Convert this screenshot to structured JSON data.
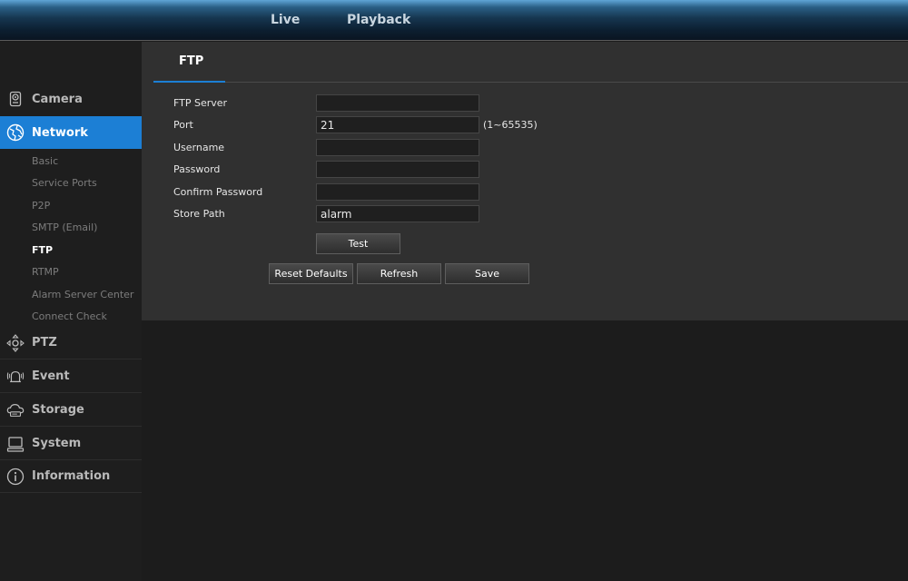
{
  "topnav": {
    "live": "Live",
    "playback": "Playback"
  },
  "sidebar": {
    "camera": "Camera",
    "network": "Network",
    "network_sub": [
      "Basic",
      "Service Ports",
      "P2P",
      "SMTP (Email)",
      "FTP",
      "RTMP",
      "Alarm Server Center",
      "Connect Check"
    ],
    "ptz": "PTZ",
    "event": "Event",
    "storage": "Storage",
    "system": "System",
    "information": "Information"
  },
  "tab": {
    "label": "FTP"
  },
  "form": {
    "ftp_server": {
      "label": "FTP Server",
      "value": ""
    },
    "port": {
      "label": "Port",
      "value": "21",
      "hint": "(1~65535)"
    },
    "username": {
      "label": "Username",
      "value": ""
    },
    "password": {
      "label": "Password",
      "value": ""
    },
    "confirm_password": {
      "label": "Confirm Password",
      "value": ""
    },
    "store_path": {
      "label": "Store Path",
      "value": "alarm"
    }
  },
  "buttons": {
    "test": "Test",
    "reset_defaults": "Reset Defaults",
    "refresh": "Refresh",
    "save": "Save"
  },
  "colors": {
    "accent": "#1c7fd5",
    "panel": "#303030",
    "background": "#1c1c1c"
  },
  "icons": [
    "camera-icon",
    "network-icon",
    "ptz-icon",
    "event-icon",
    "storage-icon",
    "system-icon",
    "information-icon"
  ]
}
